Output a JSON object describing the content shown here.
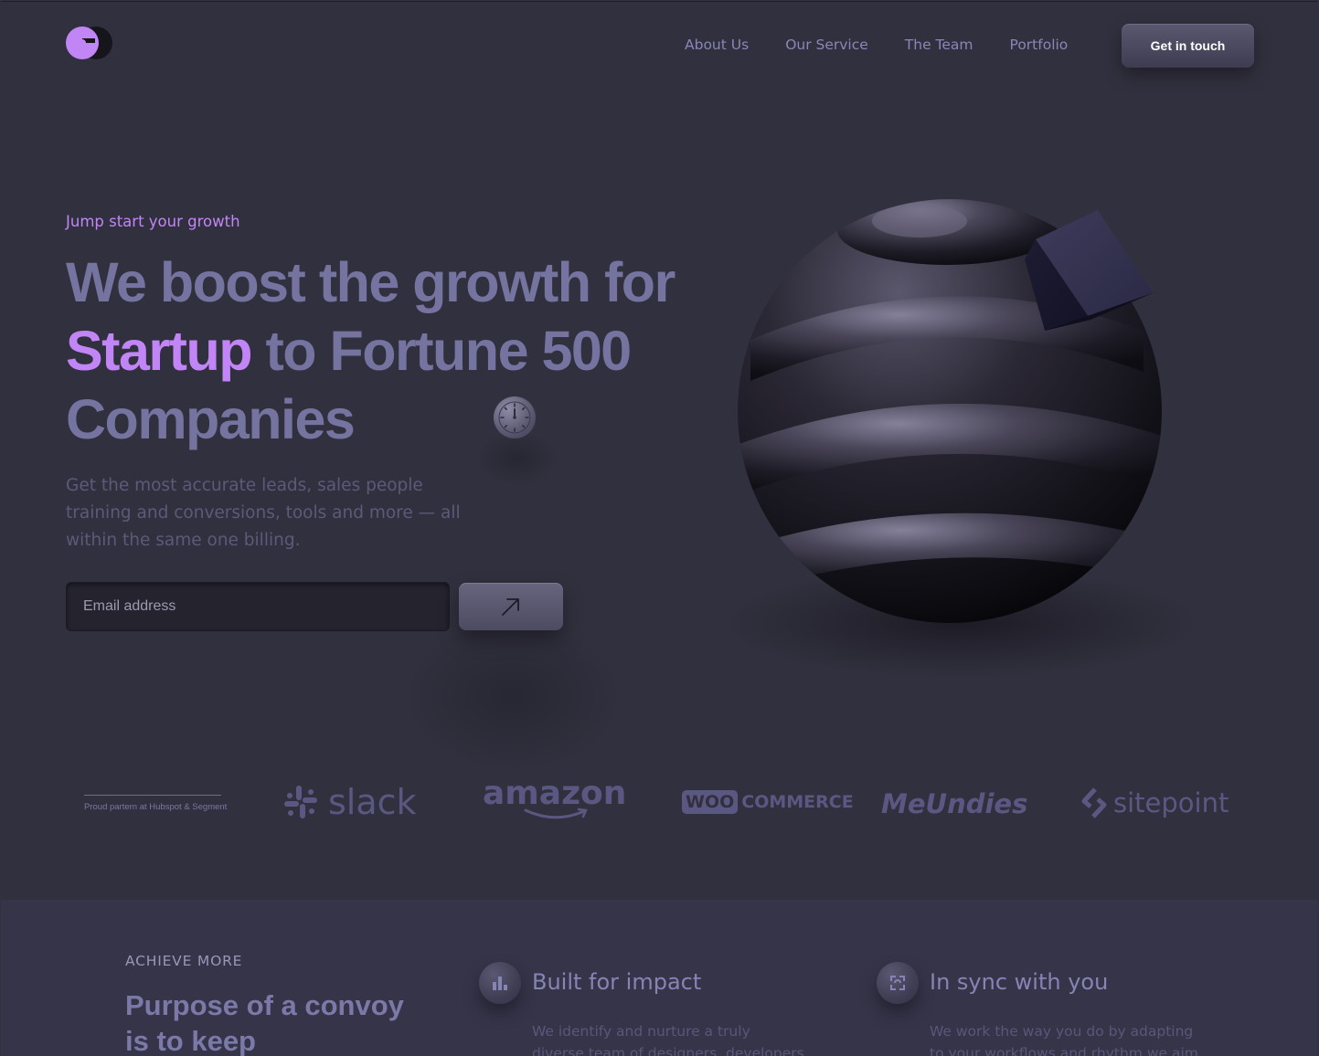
{
  "nav": {
    "items": [
      {
        "label": "About Us"
      },
      {
        "label": "Our Service"
      },
      {
        "label": "The Team"
      },
      {
        "label": "Portfolio"
      }
    ],
    "cta_label": "Get in touch"
  },
  "hero": {
    "eyebrow": "Jump start your growth",
    "headline_part1": "We boost the growth for ",
    "headline_highlight": "Startup",
    "headline_part2": " to Fortune 500 Companies",
    "subtext": "Get the most accurate leads, sales people training and conversions, tools and more — all within the same one billing.",
    "email_placeholder": "Email address",
    "submit_icon": "arrow-up-right-icon"
  },
  "partners": {
    "caption": "Proud partern at Hubspot & Segment",
    "logos": [
      {
        "name": "slack",
        "text": "slack"
      },
      {
        "name": "amazon",
        "text": "amazon"
      },
      {
        "name": "woocommerce",
        "badge": "WOO",
        "text": "COMMERCE"
      },
      {
        "name": "meundies",
        "text": "MeUndies"
      },
      {
        "name": "sitepoint",
        "text": "sitepoint"
      }
    ]
  },
  "features": {
    "eyebrow": "ACHIEVE MORE",
    "title": "Purpose of a convoy is to keep",
    "cards": [
      {
        "icon": "bar-chart-icon",
        "title": "Built for impact",
        "body": "We identify and nurture a truly diverse team of designers, developers and"
      },
      {
        "icon": "sync-icon",
        "title": "In sync with you",
        "body": "We work the way you do by adapting to your workflows and rhythm we aim"
      }
    ]
  },
  "colors": {
    "background": "#31303e",
    "accent": "#c285f5",
    "headline": "#75739f"
  }
}
